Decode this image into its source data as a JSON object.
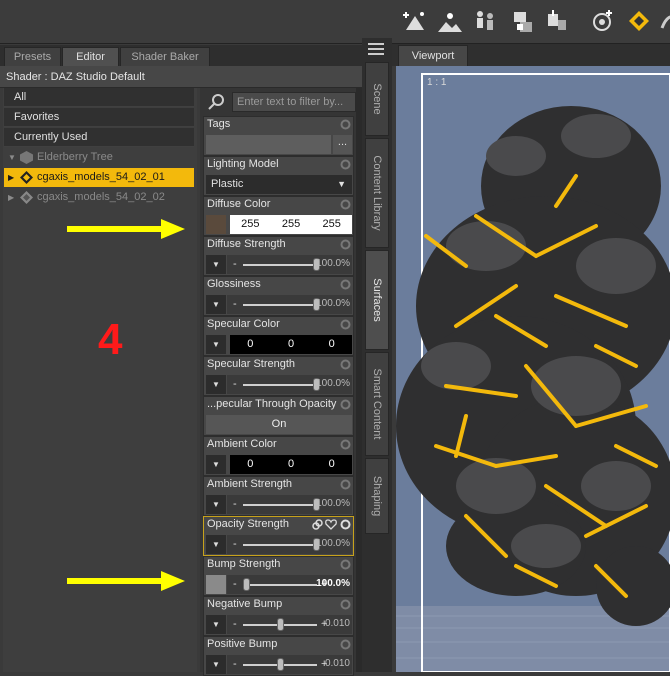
{
  "toolbar": {
    "icons": [
      "add-node-icon",
      "sun-light-icon",
      "figures-icon",
      "lock-icon",
      "transform-icon",
      "universal-tool-icon",
      "surface-selection-icon",
      "node-weight-icon"
    ]
  },
  "tabs": [
    {
      "label": "Presets",
      "active": false
    },
    {
      "label": "Editor",
      "active": true
    },
    {
      "label": "Shader Baker",
      "active": false
    }
  ],
  "shader_label": "Shader : DAZ Studio Default",
  "left_list": [
    "All",
    "Favorites",
    "Currently Used"
  ],
  "tree": [
    {
      "label": "Elderberry Tree",
      "selected": false,
      "icon": "figure-icon"
    },
    {
      "label": "cgaxis_models_54_02_01",
      "selected": true,
      "icon": "surface-icon"
    },
    {
      "label": "cgaxis_models_54_02_02",
      "selected": false,
      "icon": "surface-icon"
    }
  ],
  "annotation_number": "4",
  "filter_placeholder": "Enter text to filter by...",
  "props": {
    "tags": {
      "name": "Tags",
      "button": "..."
    },
    "lighting_model": {
      "name": "Lighting Model",
      "value": "Plastic"
    },
    "diffuse_color": {
      "name": "Diffuse Color",
      "r": "255",
      "g": "255",
      "b": "255"
    },
    "diffuse_strength": {
      "name": "Diffuse Strength",
      "value": "100.0%",
      "level": 1.0
    },
    "glossiness": {
      "name": "Glossiness",
      "value": "100.0%",
      "level": 1.0
    },
    "specular_color": {
      "name": "Specular Color",
      "r": "0",
      "g": "0",
      "b": "0"
    },
    "specular_strength": {
      "name": "Specular Strength",
      "value": "100.0%",
      "level": 1.0
    },
    "spec_through_opacity": {
      "name": "...pecular Through Opacity",
      "value": "On"
    },
    "ambient_color": {
      "name": "Ambient Color",
      "r": "0",
      "g": "0",
      "b": "0"
    },
    "ambient_strength": {
      "name": "Ambient Strength",
      "value": "100.0%",
      "level": 1.0
    },
    "opacity_strength": {
      "name": "Opacity Strength",
      "value": "100.0%",
      "level": 1.0
    },
    "bump_strength": {
      "name": "Bump Strength",
      "value": "100.0%",
      "level": 0.0
    },
    "negative_bump": {
      "name": "Negative Bump",
      "value": "-0.010",
      "level": 0.5
    },
    "positive_bump": {
      "name": "Positive Bump",
      "value": "0.010",
      "level": 0.5
    }
  },
  "side_tabs": [
    "Scene",
    "Content Library",
    "Surfaces",
    "Smart Content",
    "Shaping"
  ],
  "viewport": {
    "tab": "Viewport",
    "ratio": "1 : 1"
  },
  "colors": {
    "accent": "#f3b90c",
    "annotation_red": "#ff1a1a",
    "arrow_yellow": "#ffff00",
    "viewport_bg": "#6b7d9c"
  }
}
